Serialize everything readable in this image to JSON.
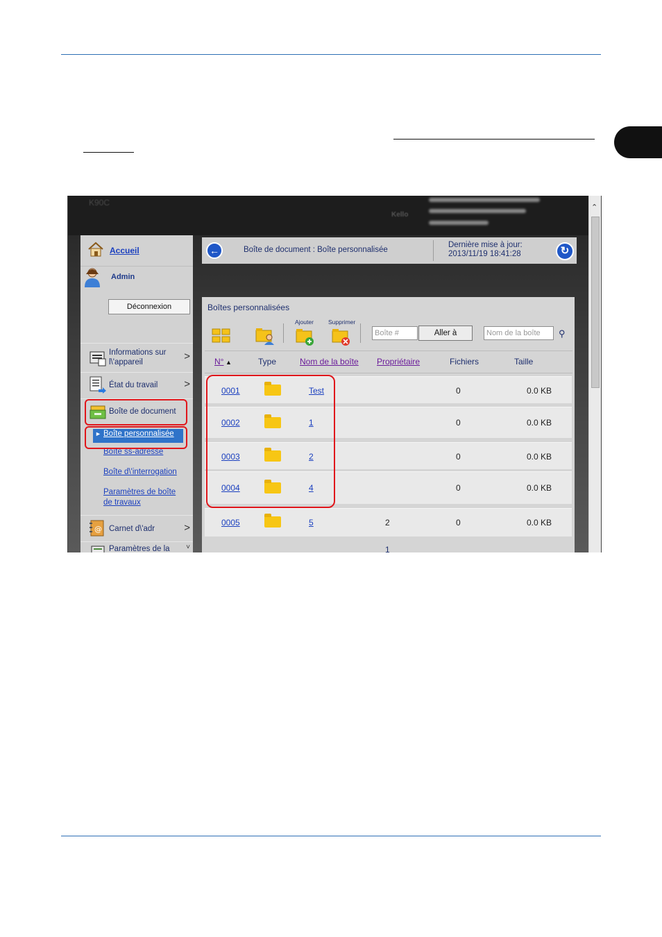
{
  "sidebar": {
    "home": "Accueil",
    "user": "Admin",
    "logout": "Déconnexion",
    "items": [
      {
        "label": "Informations sur l\\'appareil"
      },
      {
        "label": "État du travail"
      },
      {
        "label": "Boîte de document"
      },
      {
        "label": "Carnet d\\'adr"
      },
      {
        "label": "Paramètres de la"
      }
    ],
    "subitems": [
      {
        "label": "Boîte personnalisée"
      },
      {
        "label": "Boîte ss-adresse"
      },
      {
        "label": "Boîte d\\'interrogation"
      },
      {
        "label": "Paramètres de boîte de travaux"
      }
    ]
  },
  "header": {
    "model": "K90C",
    "logo": "Kello",
    "breadcrumb": "Boîte de document : Boîte personnalisée",
    "updated_label": "Dernière mise à jour:",
    "updated_time": "2013/11/19 18:41:28"
  },
  "panel": {
    "title": "Boîtes personnalisées",
    "add_label": "Ajouter",
    "delete_label": "Supprimer",
    "box_number_placeholder": "Boîte #",
    "goto": "Aller à",
    "box_name_placeholder": "Nom de la boîte"
  },
  "table": {
    "columns": [
      "N°",
      "Type",
      "Nom de la boîte",
      "Propriétaire",
      "Fichiers",
      "Taille"
    ],
    "rows": [
      {
        "no": "0001",
        "name": "Test",
        "owner": "",
        "files": "0",
        "size": "0.0 KB"
      },
      {
        "no": "0002",
        "name": "1",
        "owner": "",
        "files": "0",
        "size": "0.0 KB"
      },
      {
        "no": "0003",
        "name": "2",
        "owner": "",
        "files": "0",
        "size": "0.0 KB"
      },
      {
        "no": "0004",
        "name": "4",
        "owner": "",
        "files": "0",
        "size": "0.0 KB"
      },
      {
        "no": "0005",
        "name": "5",
        "owner": "2",
        "files": "0",
        "size": "0.0 KB"
      }
    ],
    "page": "1"
  },
  "colors": {
    "page_rule": "#2e6fb5",
    "link": "#1a3fbf",
    "highlight": "#e0161b",
    "active_nav": "#2f73c9"
  }
}
